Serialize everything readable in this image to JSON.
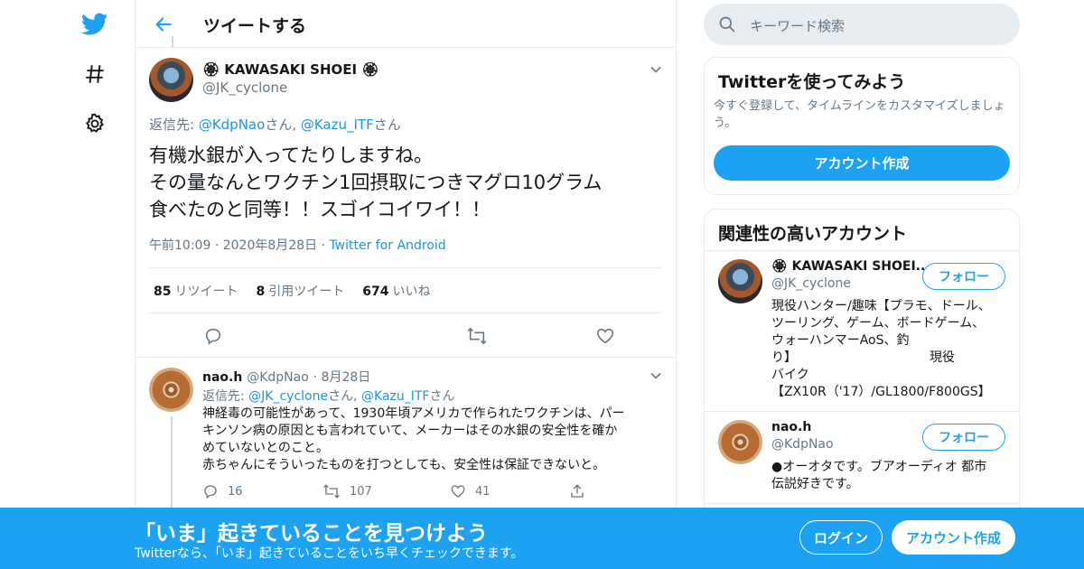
{
  "colors": {
    "accent": "#1da1f2",
    "link": "#1b95e0",
    "muted": "#657786",
    "border": "#e6ecf0"
  },
  "nav": {
    "icons": [
      "twitter-logo-icon",
      "hashtag-icon",
      "settings-gear-icon"
    ]
  },
  "header": {
    "title": "ツイートする"
  },
  "tweet": {
    "name": "🏵 KAWASAKI SHOEI 🏵",
    "handle": "@JK_cyclone",
    "reply_prefix": "返信先: ",
    "reply_user1": "@KdpNao",
    "reply_suffix1": "さん, ",
    "reply_user2": "@Kazu_ITF",
    "reply_suffix2": "さん",
    "text_lines": [
      "有機水銀が入ってたりしますね。",
      "その量なんとワクチン1回摂取につきマグロ10グラム",
      "食べたのと同等！！スゴイコイワイ！！"
    ],
    "time": "午前10:09",
    "date": "2020年8月28日",
    "dot": "·",
    "source": "Twitter for Android",
    "retweets": "85",
    "retweets_label": "リツイート",
    "quotes": "8",
    "quotes_label": "引用ツイート",
    "likes": "674",
    "likes_label": "いいね"
  },
  "reply": {
    "name": "nao.h",
    "handle": "@KdpNao",
    "date": "· 8月28日",
    "reply_prefix": "返信先: ",
    "reply_user1": "@JK_cyclone",
    "reply_suffix1": "さん, ",
    "reply_user2": "@Kazu_ITF",
    "reply_suffix2": "さん",
    "text_lines": [
      "神経毒の可能性があって、1930年頃アメリカで作られたワクチンは、パー",
      "キンソン病の原因とも言われていて、メーカーはその水銀の安全性を確か",
      "めていないとのこと。",
      "赤ちゃんにそういったものを打つとしても、安全性は保証できないと。"
    ],
    "replies": "16",
    "retweets": "107",
    "likes": "41"
  },
  "search": {
    "placeholder": "キーワード検索"
  },
  "signup_card": {
    "title": "Twitterを使ってみよう",
    "desc": "今すぐ登録して、タイムラインをカスタマイズしましょう。",
    "button": "アカウント作成"
  },
  "related": {
    "title": "関連性の高いアカウント",
    "follow_label": "フォロー",
    "accounts": [
      {
        "name": "🏵 KAWASAKI SHOEI...",
        "handle": "@JK_cyclone",
        "bio_lines": [
          "現役ハンター/趣味【プラモ、ドール、",
          "ツーリング、ゲーム、ボードゲーム、",
          "ウォーハンマーAoS、釣",
          "り】　　　　　　　　　　　現役",
          "バイク",
          "【ZX10R（'17）/GL1800/F800GS】"
        ]
      },
      {
        "name": "nao.h",
        "handle": "@KdpNao",
        "bio_lines": [
          "●オーオタです。ブアオーディオ 都市",
          "伝説好きです。"
        ]
      }
    ]
  },
  "banner": {
    "title": "「いま」起きていることを見つけよう",
    "subtitle": "Twitterなら、「いま」起きていることをいち早くチェックできます。",
    "login": "ログイン",
    "signup": "アカウント作成"
  }
}
